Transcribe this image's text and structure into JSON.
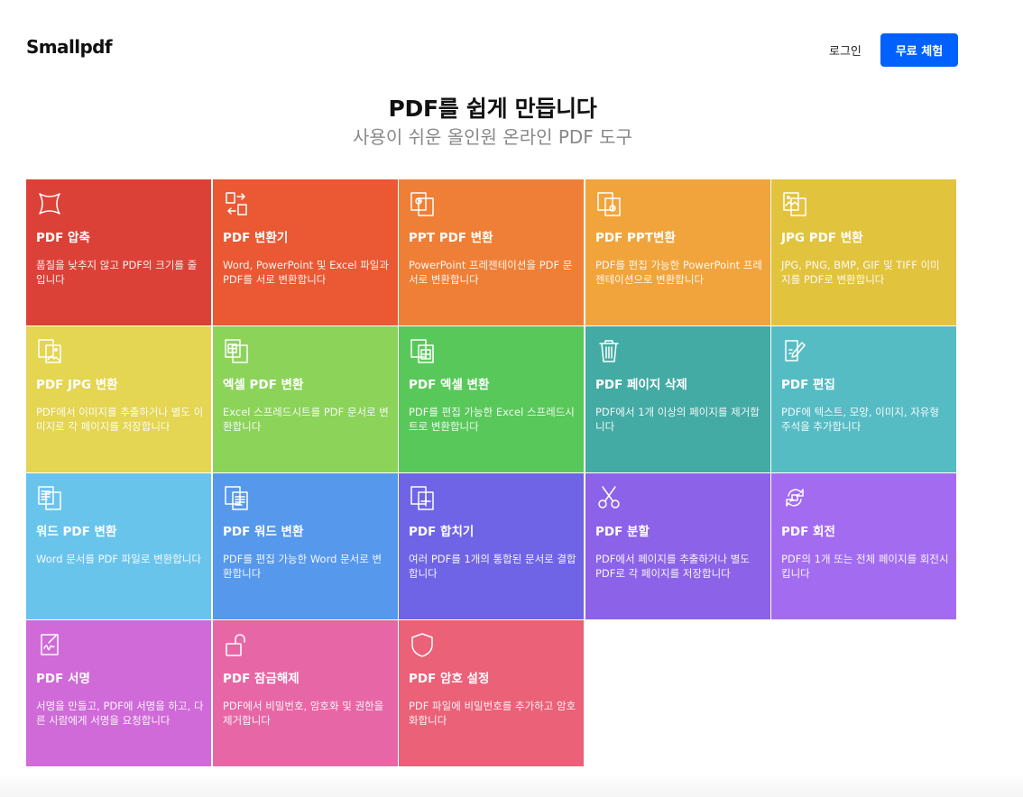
{
  "header": {
    "logo": "Smallpdf",
    "login": "로그인",
    "trial_button": "무료 체험",
    "trial_color": "#0061fe"
  },
  "hero": {
    "title": "PDF를 쉽게 만듭니다",
    "subtitle": "사용이 쉬운 올인원 온라인 PDF 도구"
  },
  "tools": [
    {
      "title": "PDF 압축",
      "desc": "품질을 낮추지 않고 PDF의 크기를 줄입니다",
      "color": "#dc4138",
      "icon": "compress-icon"
    },
    {
      "title": "PDF 변환기",
      "desc": "Word, PowerPoint 및 Excel 파일과 PDF를 서로 변환합니다",
      "color": "#ea5834",
      "icon": "convert-icon"
    },
    {
      "title": "PPT PDF 변환",
      "desc": "PowerPoint 프레젠테이션을 PDF 문서로 변환합니다",
      "color": "#ef7f36",
      "icon": "ppt-to-pdf-icon"
    },
    {
      "title": "PDF PPT변환",
      "desc": "PDF를 편집 가능한 PowerPoint 프레젠테이션으로 변환합니다",
      "color": "#f1a43c",
      "icon": "pdf-to-ppt-icon"
    },
    {
      "title": "JPG PDF 변환",
      "desc": "JPG, PNG, BMP, GIF 및 TIFF 이미지를 PDF로 변환합니다",
      "color": "#e2c33e",
      "icon": "jpg-to-pdf-icon"
    },
    {
      "title": "PDF JPG 변환",
      "desc": "PDF에서 이미지를 추출하거나 별도 이미지로 각 페이지를 저장합니다",
      "color": "#e4d552",
      "icon": "pdf-to-jpg-icon"
    },
    {
      "title": "엑셀 PDF 변환",
      "desc": "Excel 스프레드시트를 PDF 문서로 변환합니다",
      "color": "#8cd35a",
      "icon": "excel-to-pdf-icon"
    },
    {
      "title": "PDF 엑셀 변환",
      "desc": "PDF를 편집 가능한 Excel 스프레드시트로 변환합니다",
      "color": "#59c85a",
      "icon": "pdf-to-excel-icon"
    },
    {
      "title": "PDF 페이지 삭제",
      "desc": "PDF에서 1개 이상의 페이지를 제거합니다",
      "color": "#44aaa4",
      "icon": "trash-icon"
    },
    {
      "title": "PDF 편집",
      "desc": "PDF에 텍스트, 모양, 이미지, 자유형 주석을 추가합니다",
      "color": "#56bcc4",
      "icon": "edit-icon"
    },
    {
      "title": "워드 PDF 변환",
      "desc": "Word 문서를 PDF 파일로 변환합니다",
      "color": "#69c4ec",
      "icon": "word-to-pdf-icon"
    },
    {
      "title": "PDF 워드 변환",
      "desc": "PDF를 편집 가능한 Word 문서로 변환합니다",
      "color": "#5698ec",
      "icon": "pdf-to-word-icon"
    },
    {
      "title": "PDF 합치기",
      "desc": "여러 PDF를 1개의 통합된 문서로 결합합니다",
      "color": "#6f64e6",
      "icon": "merge-icon"
    },
    {
      "title": "PDF 분할",
      "desc": "PDF에서 페이지를 추출하거나 별도 PDF로 각 페이지를 저장합니다",
      "color": "#8c63e8",
      "icon": "scissors-icon"
    },
    {
      "title": "PDF 회전",
      "desc": "PDF의 1개 또는 전체 페이지를 회전시킵니다",
      "color": "#a36cf0",
      "icon": "rotate-icon"
    },
    {
      "title": "PDF 서명",
      "desc": "서명을 만들고, PDF에 서명을 하고, 다른 사람에게 서명을 요청합니다",
      "color": "#cf6ad8",
      "icon": "sign-icon"
    },
    {
      "title": "PDF 잠금해제",
      "desc": "PDF에서 비밀번호, 암호화 및 권한을 제거합니다",
      "color": "#e767a6",
      "icon": "unlock-icon"
    },
    {
      "title": "PDF 암호 설정",
      "desc": "PDF 파일에 비밀번호를 추가하고 암호화합니다",
      "color": "#ea6178",
      "icon": "shield-icon"
    }
  ]
}
